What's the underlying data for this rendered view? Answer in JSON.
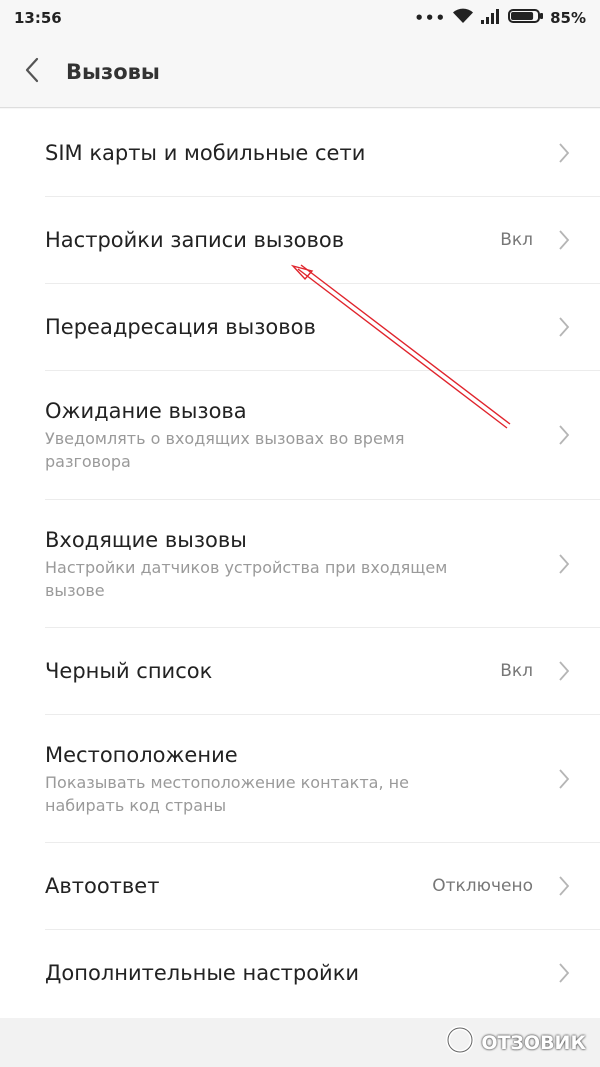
{
  "status_bar": {
    "time": "13:56",
    "dots": "•••",
    "battery_percent": "85%",
    "battery_level": 0.85,
    "icons": [
      "wifi-icon",
      "signal-icon",
      "battery-icon"
    ]
  },
  "header": {
    "title": "Вызовы",
    "back_icon": "chevron-left-icon"
  },
  "items": [
    {
      "title": "SIM карты и мобильные сети",
      "subtitle": "",
      "value": ""
    },
    {
      "title": "Настройки записи вызовов",
      "subtitle": "",
      "value": "Вкл"
    },
    {
      "title": "Переадресация вызовов",
      "subtitle": "",
      "value": ""
    },
    {
      "title": "Ожидание вызова",
      "subtitle": "Уведомлять о входящих вызовах во время разговора",
      "value": ""
    },
    {
      "title": "Входящие вызовы",
      "subtitle": "Настройки датчиков устройства при входящем вызове",
      "value": ""
    },
    {
      "title": "Черный список",
      "subtitle": "",
      "value": "Вкл"
    },
    {
      "title": "Местоположение",
      "subtitle": "Показывать местоположение контакта, не набирать код страны",
      "value": ""
    },
    {
      "title": "Автоответ",
      "subtitle": "",
      "value": "Отключено"
    },
    {
      "title": "Дополнительные настройки",
      "subtitle": "",
      "value": ""
    }
  ],
  "watermark": {
    "text": "ОТЗОВИК"
  },
  "colors": {
    "background": "#f7f7f7",
    "list_background": "#ffffff",
    "annotation_arrow": "#e0242c"
  }
}
